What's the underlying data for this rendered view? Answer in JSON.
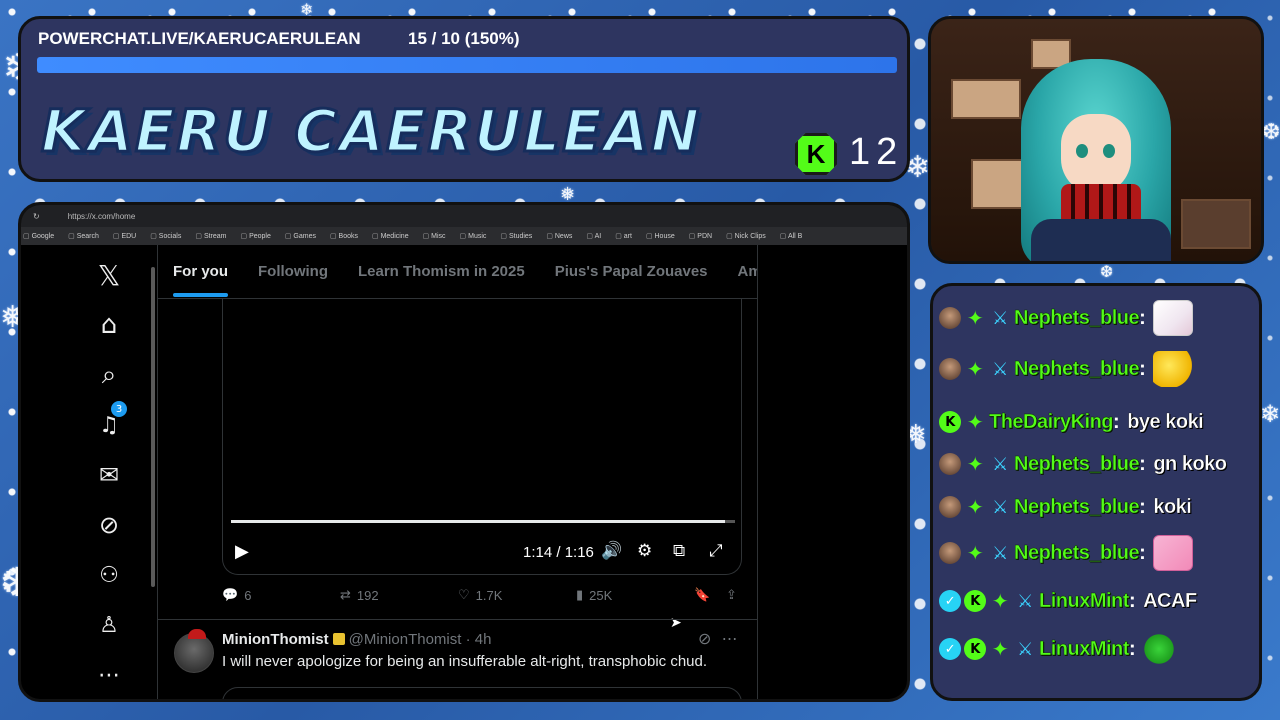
{
  "goal": {
    "label": "POWERCHAT.LIVE/KAERUCAERULEAN",
    "progress_text": "15 / 10 (150%)",
    "progress_fraction": 1.0
  },
  "stream": {
    "title": "KAERU CAERULEAN",
    "platform_badge": "K",
    "viewer_count": "12"
  },
  "browser": {
    "url": "https://x.com/home",
    "bookmarks": [
      "Google",
      "Search",
      "EDU",
      "Socials",
      "Stream",
      "People",
      "Games",
      "Books",
      "Medicine",
      "Misc",
      "Music",
      "Studies",
      "News",
      "AI",
      "art",
      "House",
      "PDN",
      "Nick Clips",
      "All B"
    ]
  },
  "x": {
    "logo": "𝕏",
    "notification_count": "3",
    "tabs": [
      {
        "label": "For you"
      },
      {
        "label": "Following"
      },
      {
        "label": "Learn Thomism in 2025"
      },
      {
        "label": "Pius's Papal Zouaves"
      },
      {
        "label": "Am"
      }
    ],
    "video": {
      "time": "1:14 / 1:16",
      "progress_fraction": 0.98
    },
    "tweet1_stats": {
      "replies": "6",
      "reposts": "192",
      "likes": "1.7K",
      "views": "25K"
    },
    "tweet2": {
      "name": "MinionThomist",
      "handle": "@MinionThomist · 4h",
      "text": "I will never apologize for being an insufferable alt-right, transphobic chud."
    }
  },
  "chat": {
    "messages": [
      {
        "user": "Nephets_blue",
        "text": "",
        "emote": "paper"
      },
      {
        "user": "Nephets_blue",
        "text": "",
        "emote": "yellow"
      },
      {
        "user": "TheDairyKing",
        "text": "bye koki",
        "emote": ""
      },
      {
        "user": "Nephets_blue",
        "text": "gn koko",
        "emote": ""
      },
      {
        "user": "Nephets_blue",
        "text": "koki",
        "emote": ""
      },
      {
        "user": "Nephets_blue",
        "text": "",
        "emote": "pink"
      },
      {
        "user": "LinuxMint",
        "text": "ACAF",
        "emote": ""
      },
      {
        "user": "LinuxMint",
        "text": "",
        "emote": "green"
      }
    ]
  },
  "colors": {
    "panel_bg": "#2e3560",
    "accent_blue": "#1d9bf0",
    "kick_green": "#53fc18"
  }
}
